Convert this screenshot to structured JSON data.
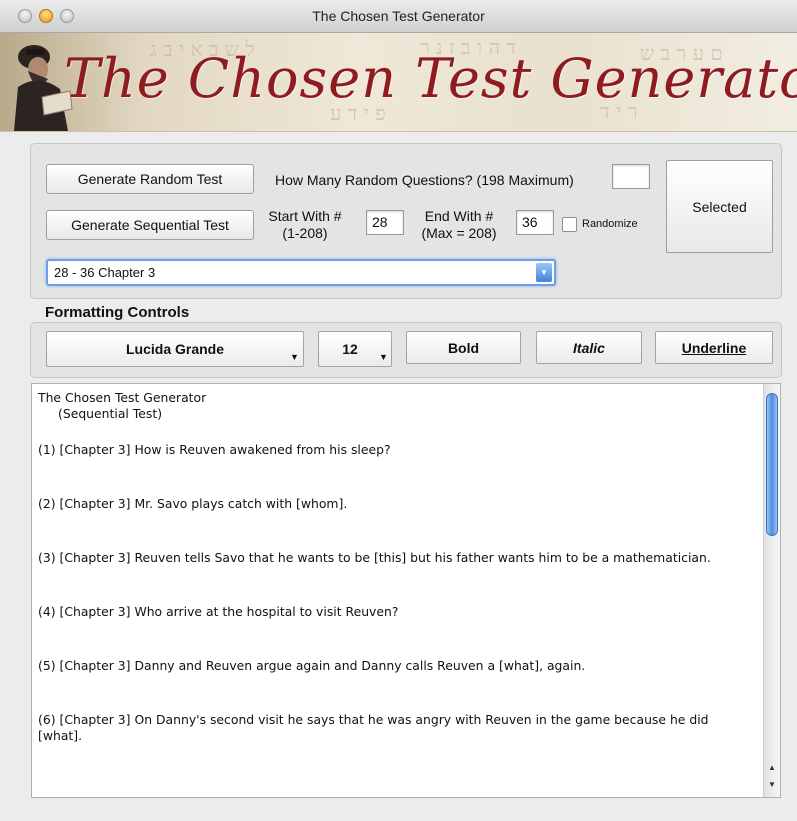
{
  "window": {
    "title": "The Chosen Test Generator"
  },
  "banner": {
    "title": "The Chosen Test Generator"
  },
  "controls": {
    "random_button": "Generate Random Test",
    "random_question_label": "How Many Random Questions? (198 Maximum)",
    "random_count_value": "",
    "sequential_button": "Generate Sequential Test",
    "start_label_1": "Start With #",
    "start_label_2": "(1-208)",
    "start_value": "28",
    "end_label_1": "End With #",
    "end_label_2": "(Max = 208)",
    "end_value": "36",
    "randomize_label": "Randomize",
    "randomize_checked": false,
    "selected_button": "Selected",
    "chapter_select_value": "28 - 36  Chapter 3"
  },
  "formatting": {
    "section_title": "Formatting Controls",
    "font_value": "Lucida Grande",
    "size_value": "12",
    "bold_label": "Bold",
    "italic_label": "Italic",
    "underline_label": "Underline"
  },
  "test": {
    "title": "The Chosen Test Generator",
    "subtitle": "(Sequential Test)",
    "questions": [
      "(1)  [Chapter 3] How is Reuven awakened from his sleep?",
      "(2)  [Chapter 3] Mr. Savo plays catch with [whom].",
      "(3)  [Chapter 3] Reuven tells Savo that he wants to be [this] but his father wants him to be a mathematician.",
      "(4)  [Chapter 3] Who arrive at the hospital to visit Reuven?",
      "(5)  [Chapter 3] Danny and Reuven argue again and Danny calls Reuven a [what], again.",
      "(6)  [Chapter 3] On Danny's second visit he says that he was angry with Reuven in the game because he did [what]."
    ]
  },
  "colors": {
    "banner_title": "#8e1b1f",
    "accent": "#4d8fe0"
  }
}
